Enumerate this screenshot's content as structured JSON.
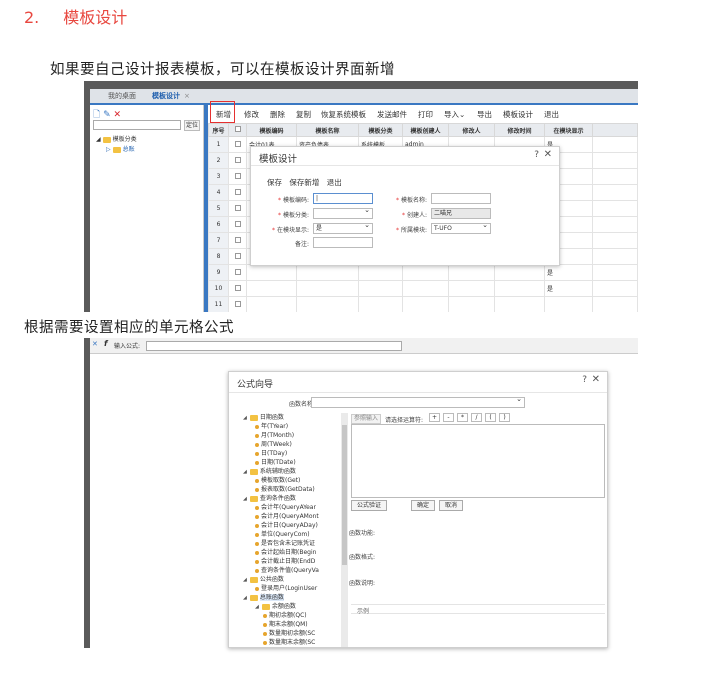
{
  "heading": {
    "number": "2.",
    "title": "模板设计"
  },
  "para1": "如果要自己设计报表模板，可以在模板设计界面新增",
  "para2": "根据需要设置相应的单元格公式",
  "shot1": {
    "tabs": [
      "我的桌面",
      "模板设计"
    ],
    "tab_close": "×",
    "locate_label": "定位",
    "tree": {
      "root": "模板分类",
      "child": "总账"
    },
    "toolbar": [
      "新增",
      "修改",
      "删除",
      "复制",
      "恢复系统模板",
      "发送邮件",
      "打印",
      "导入⌄",
      "导出",
      "模板设计",
      "退出"
    ],
    "columns": [
      "序号",
      "",
      "模板编码",
      "模板名称",
      "模板分类",
      "模板创建人",
      "修改人",
      "修改时间",
      "在模块显示"
    ],
    "rows": [
      {
        "num": "1",
        "code": "会计01表",
        "name": "资产负债表",
        "cat": "系统模板",
        "creator": "admin",
        "show": "是"
      },
      {
        "num": "2",
        "code": "",
        "name": "",
        "cat": "",
        "creator": "",
        "show": "是"
      },
      {
        "num": "3",
        "code": "",
        "name": "",
        "cat": "",
        "creator": "",
        "show": "是"
      },
      {
        "num": "4",
        "code": "",
        "name": "",
        "cat": "",
        "creator": "",
        "show": "是"
      },
      {
        "num": "5",
        "code": "",
        "name": "",
        "cat": "",
        "creator": "",
        "show": "是"
      },
      {
        "num": "6",
        "code": "",
        "name": "",
        "cat": "",
        "creator": "",
        "show": "是"
      },
      {
        "num": "7",
        "code": "",
        "name": "",
        "cat": "",
        "creator": "",
        "show": "是"
      },
      {
        "num": "8",
        "code": "",
        "name": "",
        "cat": "",
        "creator": "",
        "show": "是"
      },
      {
        "num": "9",
        "code": "",
        "name": "",
        "cat": "",
        "creator": "",
        "show": "是"
      },
      {
        "num": "10",
        "code": "",
        "name": "",
        "cat": "",
        "creator": "",
        "show": "是"
      },
      {
        "num": "11",
        "code": "",
        "name": "",
        "cat": "",
        "creator": "",
        "show": ""
      }
    ],
    "dialog": {
      "title": "模板设计",
      "help": "?",
      "close": "✕",
      "actions": [
        "保存",
        "保存新增",
        "退出"
      ],
      "fields": {
        "code_label": "模板编码:",
        "name_label": "模板名称:",
        "category_label": "模板分类:",
        "creator_label": "创建人:",
        "creator_value": "二喵兄",
        "show_label": "在模块显示:",
        "show_value": "是",
        "module_label": "所属模块:",
        "module_value": "T-UFO",
        "remark_label": "备注:"
      }
    }
  },
  "shot2": {
    "formula_bar": {
      "marker": "✕",
      "fx": "f",
      "label": "输入公式:"
    },
    "dialog": {
      "title": "公式向导",
      "help": "?",
      "close": "✕",
      "fn_search_label": "函数名称或说明:",
      "ref_button": "参照输入",
      "op_label": "请选择运算符:",
      "operators": [
        "+",
        "-",
        "*",
        "/",
        "(",
        ")"
      ],
      "buttons": [
        "公式验证",
        "确定",
        "取消"
      ],
      "info_labels": [
        "函数功能:",
        "函数格式:",
        "函数说明:"
      ],
      "example_label": "示例",
      "tree": [
        {
          "level": 1,
          "type": "folder",
          "text": "日期函数"
        },
        {
          "level": 2,
          "type": "leaf",
          "text": "年(TYear)"
        },
        {
          "level": 2,
          "type": "leaf",
          "text": "月(TMonth)"
        },
        {
          "level": 2,
          "type": "leaf",
          "text": "周(TWeek)"
        },
        {
          "level": 2,
          "type": "leaf",
          "text": "日(TDay)"
        },
        {
          "level": 2,
          "type": "leaf",
          "text": "日期(TDate)"
        },
        {
          "level": 1,
          "type": "folder",
          "text": "系统辅助函数"
        },
        {
          "level": 2,
          "type": "leaf",
          "text": "模板取数(Get)"
        },
        {
          "level": 2,
          "type": "leaf",
          "text": "报表取数(GetData)"
        },
        {
          "level": 1,
          "type": "folder",
          "text": "查询条件函数"
        },
        {
          "level": 2,
          "type": "leaf",
          "text": "会计年(QueryAYear"
        },
        {
          "level": 2,
          "type": "leaf",
          "text": "会计月(QueryAMont"
        },
        {
          "level": 2,
          "type": "leaf",
          "text": "会计日(QueryADay)"
        },
        {
          "level": 2,
          "type": "leaf",
          "text": "单位(QueryCom)"
        },
        {
          "level": 2,
          "type": "leaf",
          "text": "是否包含未记账凭证"
        },
        {
          "level": 2,
          "type": "leaf",
          "text": "会计起始日期(Begin"
        },
        {
          "level": 2,
          "type": "leaf",
          "text": "会计截止日期(EndD"
        },
        {
          "level": 2,
          "type": "leaf",
          "text": "查询条件值(QueryVa"
        },
        {
          "level": 1,
          "type": "folder",
          "text": "公共函数"
        },
        {
          "level": 2,
          "type": "leaf",
          "text": "登录用户(LoginUser"
        },
        {
          "level": 1,
          "type": "folder",
          "text": "总账函数",
          "highlight": true
        },
        {
          "level": 2,
          "type": "folder",
          "text": "余额函数"
        },
        {
          "level": 3,
          "type": "leaf",
          "text": "期初余额(QC)"
        },
        {
          "level": 3,
          "type": "leaf",
          "text": "期末余额(QM)"
        },
        {
          "level": 3,
          "type": "leaf",
          "text": "数量期初余额(SC"
        },
        {
          "level": 3,
          "type": "leaf",
          "text": "数量期末余额(SC"
        }
      ]
    }
  }
}
